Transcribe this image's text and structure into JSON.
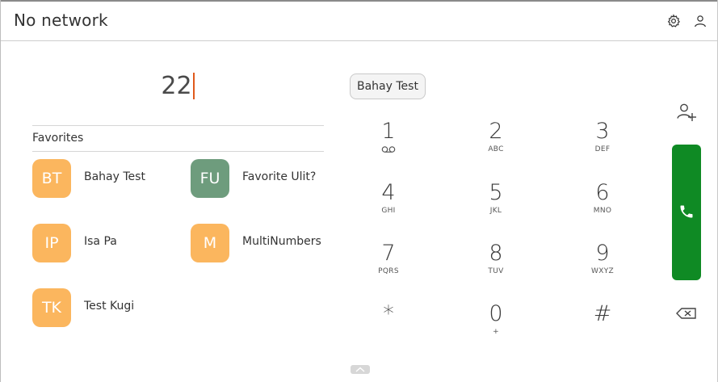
{
  "header": {
    "title": "No network",
    "settings_icon": "gear-icon",
    "account_icon": "person-icon"
  },
  "dialer": {
    "number": "22"
  },
  "favorites": {
    "header": "Favorites",
    "items": [
      {
        "initials": "BT",
        "name": "Bahay Test",
        "color": "#fbb65e"
      },
      {
        "initials": "FU",
        "name": "Favorite Ulit?",
        "color": "#6e9c7d"
      },
      {
        "initials": "IP",
        "name": "Isa Pa",
        "color": "#fbb65e"
      },
      {
        "initials": "M",
        "name": "MultiNumbers",
        "color": "#fbb65e"
      },
      {
        "initials": "TK",
        "name": "Test Kugi",
        "color": "#fbb65e"
      }
    ]
  },
  "suggestion": {
    "label": "Bahay Test"
  },
  "keypad": {
    "keys": [
      {
        "digit": "1",
        "sub": "",
        "sub_icon": "voicemail-icon"
      },
      {
        "digit": "2",
        "sub": "ABC"
      },
      {
        "digit": "3",
        "sub": "DEF"
      },
      {
        "digit": "4",
        "sub": "GHI"
      },
      {
        "digit": "5",
        "sub": "JKL"
      },
      {
        "digit": "6",
        "sub": "MNO"
      },
      {
        "digit": "7",
        "sub": "PQRS"
      },
      {
        "digit": "8",
        "sub": "TUV"
      },
      {
        "digit": "9",
        "sub": "WXYZ"
      },
      {
        "digit": "*",
        "sub": ""
      },
      {
        "digit": "0",
        "sub": "+"
      },
      {
        "digit": "#",
        "sub": ""
      }
    ]
  },
  "actions": {
    "add_contact_icon": "add-person-icon",
    "call_icon": "phone-icon",
    "call_color": "#0f8a24",
    "backspace_icon": "backspace-icon",
    "handle_icon": "chevron-up-icon"
  },
  "colors": {
    "caret": "#e05a1c",
    "avatar_orange": "#fbb65e",
    "avatar_green": "#6e9c7d"
  }
}
